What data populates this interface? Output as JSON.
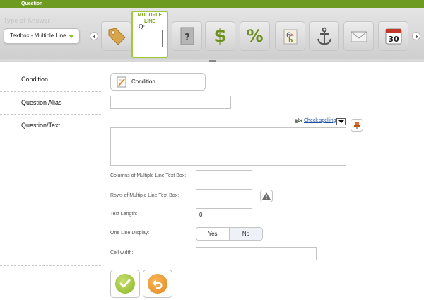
{
  "header": {
    "title": "Question"
  },
  "answer_type": {
    "title": "Type of Answer",
    "selected_value": "Textbox - Multiple Line"
  },
  "toolbar": {
    "selected_tile": {
      "label": "MULTIPLE LINE",
      "prefix": "Q:"
    },
    "tiles": [
      {
        "icon": "price-tag-icon"
      },
      {
        "icon": "unknown-document-icon",
        "text": "?"
      },
      {
        "icon": "dollar-icon",
        "text": "$"
      },
      {
        "icon": "percent-icon",
        "text": "%"
      },
      {
        "icon": "text-format-icon"
      },
      {
        "icon": "anchor-icon"
      },
      {
        "icon": "envelope-icon"
      },
      {
        "icon": "calendar-icon",
        "text": "30"
      }
    ]
  },
  "form": {
    "condition_label": "Condition",
    "condition_button": "Condition",
    "alias_label": "Question Alias",
    "alias_value": "",
    "question_label": "Question/Text",
    "question_value": "",
    "check_spelling": "Check spelling",
    "columns_label": "Columns of Multiple Line Text Box:",
    "columns_value": "",
    "rows_label": "Rows of Multiple Line Text Box:",
    "rows_value": "",
    "text_length_label": "Text Length:",
    "text_length_value": "0",
    "one_line_label": "One Line Display:",
    "one_line_options": [
      "Yes",
      "No"
    ],
    "one_line_selected": "No",
    "cell_width_label": "Cell width:",
    "cell_width_value": ""
  },
  "colors": {
    "header_green": "#6d9a21",
    "accent_green": "#9fcb3b",
    "link_blue": "#1a4fa7",
    "save_green": "#8bb524",
    "back_orange": "#e4861d"
  }
}
